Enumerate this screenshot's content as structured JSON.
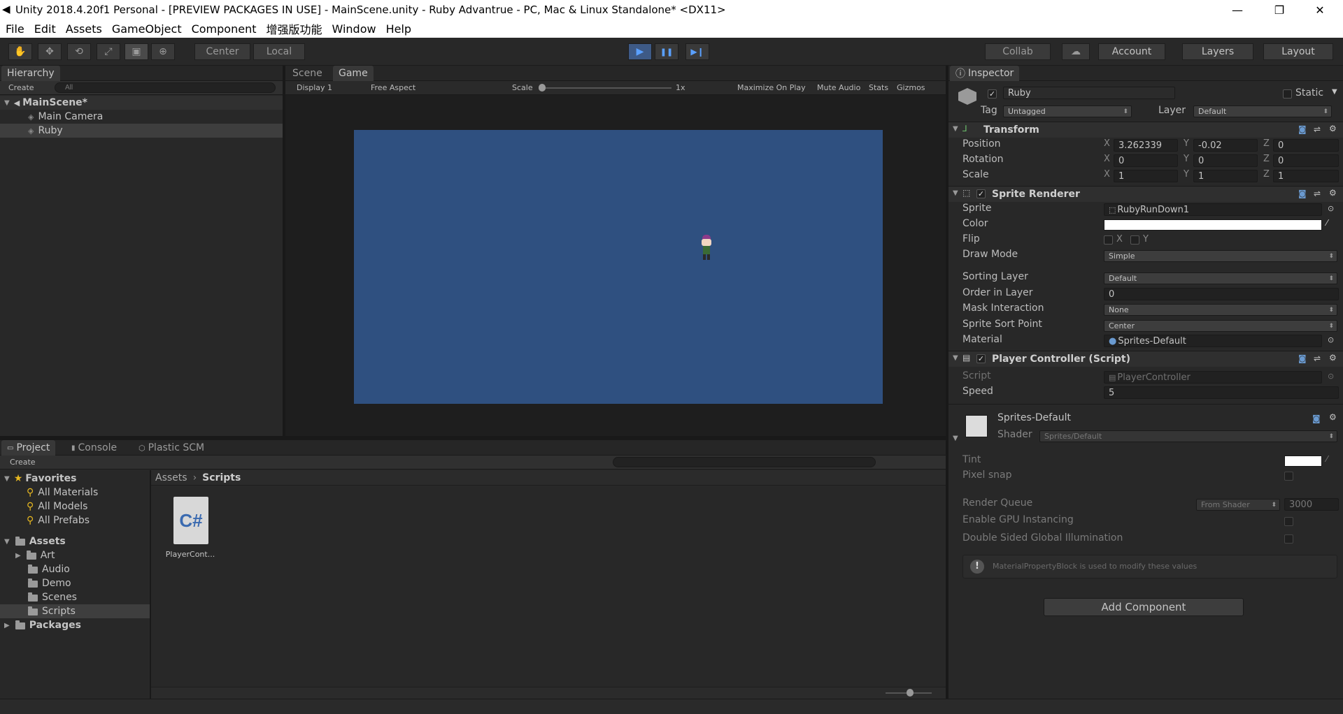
{
  "window": {
    "title": "Unity 2018.4.20f1 Personal - [PREVIEW PACKAGES IN USE] - MainScene.unity - Ruby Advantrue - PC, Mac & Linux Standalone* <DX11>",
    "minimize": "—",
    "restore": "❐",
    "close": "✕"
  },
  "menu": [
    "File",
    "Edit",
    "Assets",
    "GameObject",
    "Component",
    "增强版功能",
    "Window",
    "Help"
  ],
  "toolbar": {
    "tools": [
      "hand-tool",
      "move-tool",
      "rotate-tool",
      "scale-tool",
      "rect-tool",
      "transform-tool"
    ],
    "tool_glyphs": [
      "✋",
      "✥",
      "⟲",
      "⤢",
      "▣",
      "⊕"
    ],
    "pivot_center": "Center",
    "pivot_local": "Local",
    "play": "▶",
    "pause": "❚❚",
    "step": "▶❙",
    "collab": "Collab",
    "cloud": "☁",
    "account": "Account",
    "layers": "Layers",
    "layout": "Layout"
  },
  "hierarchy": {
    "tab": "Hierarchy",
    "create": "Create",
    "search_placeholder": "All",
    "scene": "MainScene*",
    "items": [
      "Main Camera",
      "Ruby"
    ]
  },
  "scene_tabs": {
    "scene": "Scene",
    "game": "Game"
  },
  "game": {
    "display": "Display 1",
    "aspect": "Free Aspect",
    "scale_label": "Scale",
    "scale_value": "1x",
    "maximize": "Maximize On Play",
    "mute": "Mute Audio",
    "stats": "Stats",
    "gizmos": "Gizmos",
    "bg_color": "#2f5080"
  },
  "inspector": {
    "tab": "Inspector",
    "object_name": "Ruby",
    "static_label": "Static",
    "tag_label": "Tag",
    "tag_value": "Untagged",
    "layer_label": "Layer",
    "layer_value": "Default",
    "transform": {
      "title": "Transform",
      "position": {
        "label": "Position",
        "x": "3.262339",
        "y": "-0.02",
        "z": "0"
      },
      "rotation": {
        "label": "Rotation",
        "x": "0",
        "y": "0",
        "z": "0"
      },
      "scale": {
        "label": "Scale",
        "x": "1",
        "y": "1",
        "z": "1"
      }
    },
    "axis_x": "X",
    "axis_y": "Y",
    "axis_z": "Z",
    "sprite_renderer": {
      "title": "Sprite Renderer",
      "sprite_label": "Sprite",
      "sprite_value": "RubyRunDown1",
      "color_label": "Color",
      "flip_label": "Flip",
      "flip_x": "X",
      "flip_y": "Y",
      "draw_mode_label": "Draw Mode",
      "draw_mode_value": "Simple",
      "sorting_layer_label": "Sorting Layer",
      "sorting_layer_value": "Default",
      "order_label": "Order in Layer",
      "order_value": "0",
      "mask_label": "Mask Interaction",
      "mask_value": "None",
      "sort_point_label": "Sprite Sort Point",
      "sort_point_value": "Center",
      "material_label": "Material",
      "material_value": "Sprites-Default"
    },
    "player_controller": {
      "title": "Player Controller (Script)",
      "script_label": "Script",
      "script_value": "PlayerController",
      "speed_label": "Speed",
      "speed_value": "5"
    },
    "material": {
      "name": "Sprites-Default",
      "shader_label": "Shader",
      "shader_value": "Sprites/Default",
      "tint_label": "Tint",
      "pixel_snap_label": "Pixel snap",
      "render_queue_label": "Render Queue",
      "render_queue_mode": "From Shader",
      "render_queue_value": "3000",
      "gpu_label": "Enable GPU Instancing",
      "double_sided_label": "Double Sided Global Illumination",
      "info": "MaterialPropertyBlock is used to modify these values"
    },
    "add_component": "Add Component"
  },
  "project": {
    "tabs": [
      "Project",
      "Console",
      "Plastic SCM"
    ],
    "create": "Create",
    "favorites": "Favorites",
    "favorite_items": [
      "All Materials",
      "All Models",
      "All Prefabs"
    ],
    "assets": "Assets",
    "asset_folders": [
      "Art",
      "Audio",
      "Demo",
      "Scenes",
      "Scripts"
    ],
    "packages": "Packages",
    "breadcrumb_root": "Assets",
    "breadcrumb_current": "Scripts",
    "file_icon_text": "C#",
    "file_name": "PlayerCont..."
  }
}
